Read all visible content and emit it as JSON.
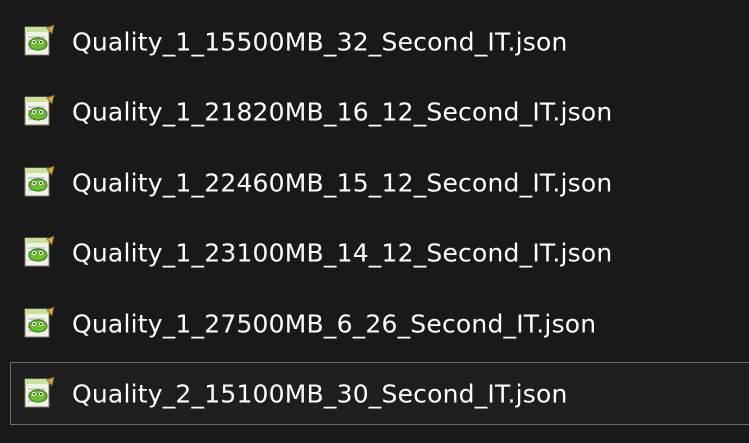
{
  "files": [
    {
      "name": "Quality_1_15500MB_32_Second_IT.json",
      "icon": "notepad-plus-plus-json-file-icon",
      "selected": false
    },
    {
      "name": "Quality_1_21820MB_16_12_Second_IT.json",
      "icon": "notepad-plus-plus-json-file-icon",
      "selected": false
    },
    {
      "name": "Quality_1_22460MB_15_12_Second_IT.json",
      "icon": "notepad-plus-plus-json-file-icon",
      "selected": false
    },
    {
      "name": "Quality_1_23100MB_14_12_Second_IT.json",
      "icon": "notepad-plus-plus-json-file-icon",
      "selected": false
    },
    {
      "name": "Quality_1_27500MB_6_26_Second_IT.json",
      "icon": "notepad-plus-plus-json-file-icon",
      "selected": false
    },
    {
      "name": "Quality_2_15100MB_30_Second_IT.json",
      "icon": "notepad-plus-plus-json-file-icon",
      "selected": true
    }
  ],
  "colors": {
    "background": "#191919",
    "text": "#ffffff",
    "selection_border": "#6b6b6b"
  }
}
